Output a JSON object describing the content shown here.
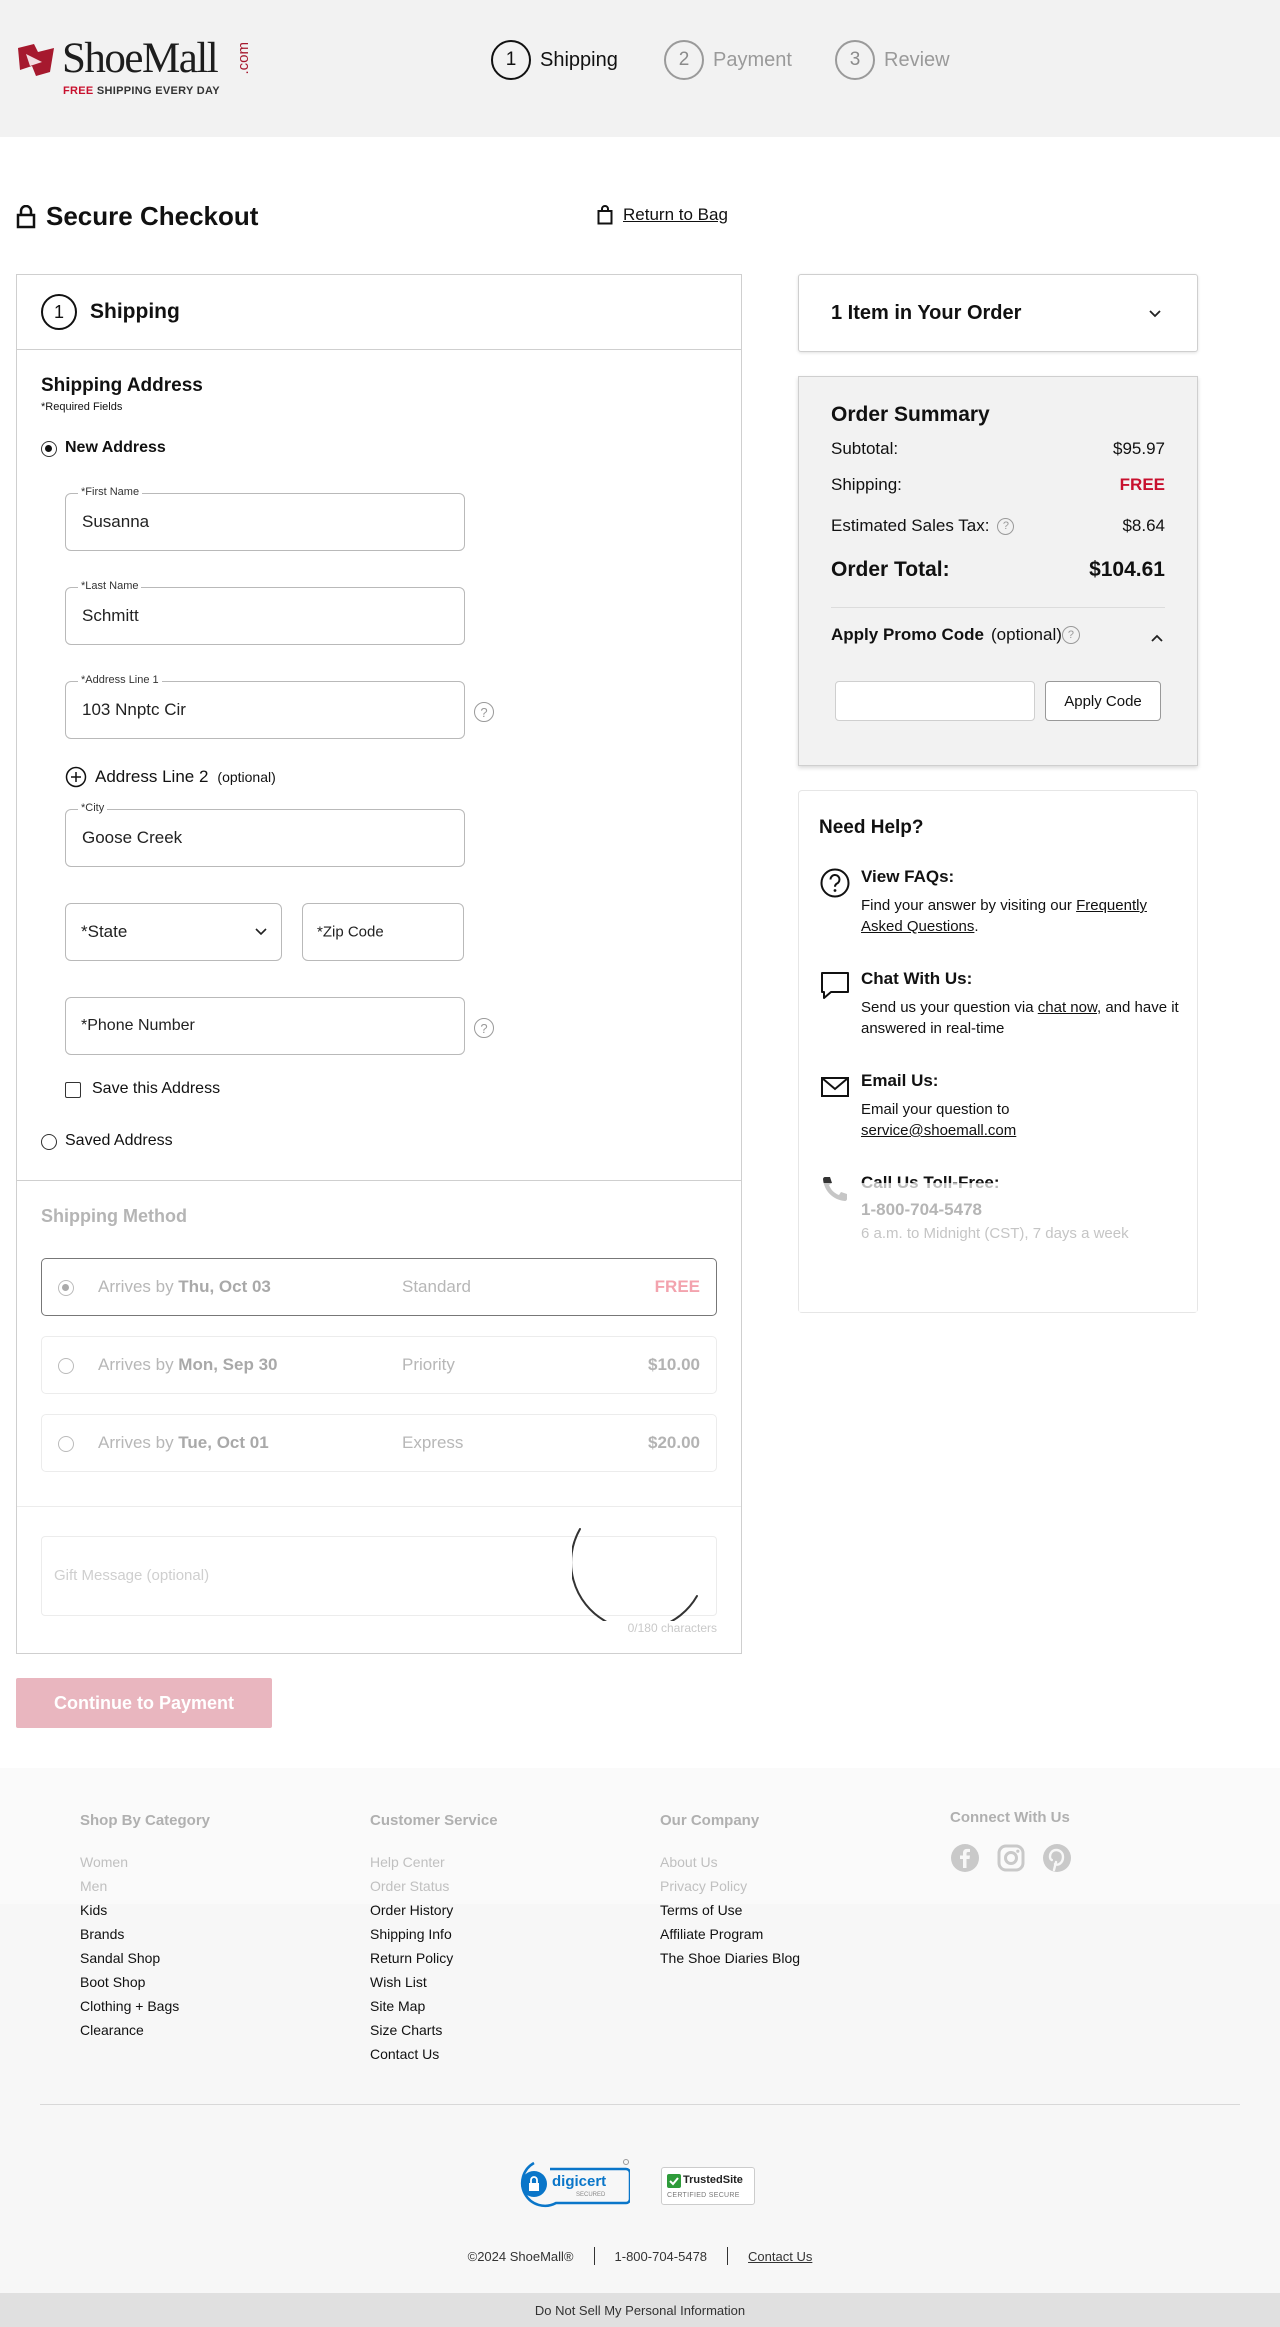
{
  "header": {
    "logo_text": "ShoeMall",
    "logo_com": ".com",
    "logo_tag_free": "FREE",
    "logo_tag_rest": " SHIPPING EVERY DAY",
    "steps": [
      {
        "num": "1",
        "label": "Shipping"
      },
      {
        "num": "2",
        "label": "Payment"
      },
      {
        "num": "3",
        "label": "Review"
      }
    ]
  },
  "page": {
    "title": "Secure Checkout",
    "return_to_bag": "Return to Bag"
  },
  "shipping": {
    "step_num": "1",
    "title": "Shipping",
    "address_heading": "Shipping Address",
    "required_note": "*Required Fields",
    "new_address": "New Address",
    "first_name_label": "*First Name",
    "first_name_value": "Susanna",
    "last_name_label": "*Last Name",
    "last_name_value": "Schmitt",
    "address1_label": "*Address Line 1",
    "address1_value": "103 Nnptc Cir",
    "address2_label": "Address Line 2",
    "address2_optional": "(optional)",
    "city_label": "*City",
    "city_value": "Goose Creek",
    "state_placeholder": "*State",
    "zip_placeholder": "*Zip Code",
    "phone_placeholder": "*Phone Number",
    "save_address": "Save this Address",
    "saved_address": "Saved Address",
    "method_heading": "Shipping Method",
    "methods": [
      {
        "prefix": "Arrives by ",
        "date": "Thu, Oct 03",
        "type": "Standard",
        "price": "FREE"
      },
      {
        "prefix": "Arrives by ",
        "date": "Mon, Sep 30",
        "type": "Priority",
        "price": "$10.00"
      },
      {
        "prefix": "Arrives by ",
        "date": "Tue, Oct 01",
        "type": "Express",
        "price": "$20.00"
      }
    ],
    "gift_placeholder": "Gift Message (optional)",
    "gift_counter": "0/180 characters",
    "continue_button": "Continue to Payment"
  },
  "order": {
    "items_title": "1 Item in Your Order",
    "summary_title": "Order Summary",
    "subtotal_label": "Subtotal:",
    "subtotal_value": "$95.97",
    "shipping_label": "Shipping:",
    "shipping_value": "FREE",
    "tax_label": "Estimated Sales Tax:",
    "tax_value": "$8.64",
    "total_label": "Order Total:",
    "total_value": "$104.61",
    "promo_label": "Apply Promo Code",
    "promo_optional": "(optional)",
    "promo_button": "Apply Code"
  },
  "help": {
    "title": "Need Help?",
    "faq_title": "View FAQs:",
    "faq_text": "Find your answer by visiting our ",
    "faq_link": "Frequently Asked Questions",
    "faq_end": ".",
    "chat_title": "Chat With Us:",
    "chat_text": "Send us your question via ",
    "chat_link": "chat now",
    "chat_end": ", and have it answered in real-time",
    "email_title": "Email Us:",
    "email_text": "Email your question to",
    "email_link": "service@shoemall.com",
    "phone_title": "Call Us Toll-Free:",
    "phone_number": "1-800-704-5478",
    "phone_hours": "6 a.m. to Midnight (CST), 7 days a week"
  },
  "footer": {
    "col1": {
      "heading": "Shop By Category",
      "links": [
        "Women",
        "Men",
        "Kids",
        "Brands",
        "Sandal Shop",
        "Boot Shop",
        "Clothing + Bags",
        "Clearance"
      ]
    },
    "col2": {
      "heading": "Customer Service",
      "links": [
        "Help Center",
        "Order Status",
        "Order History",
        "Shipping Info",
        "Return Policy",
        "Wish List",
        "Site Map",
        "Size Charts",
        "Contact Us"
      ]
    },
    "col3": {
      "heading": "Our Company",
      "links": [
        "About Us",
        "Privacy Policy",
        "Terms of Use",
        "Affiliate Program",
        "The Shoe Diaries Blog"
      ]
    },
    "col4": {
      "heading": "Connect With Us"
    },
    "digicert_text": "digicert",
    "digicert_sub": "SECURED",
    "trusted_text": "TrustedSite",
    "trusted_sub": "CERTIFIED SECURE",
    "copyright": "©2024 ShoeMall®",
    "phone": "1-800-704-5478",
    "contact": "Contact Us",
    "do_not_sell": "Do Not Sell My Personal Information"
  },
  "colors": {
    "brand_red": "#a6192e",
    "free_red": "#c8102e",
    "continue_disabled": "#e9b6bf"
  }
}
